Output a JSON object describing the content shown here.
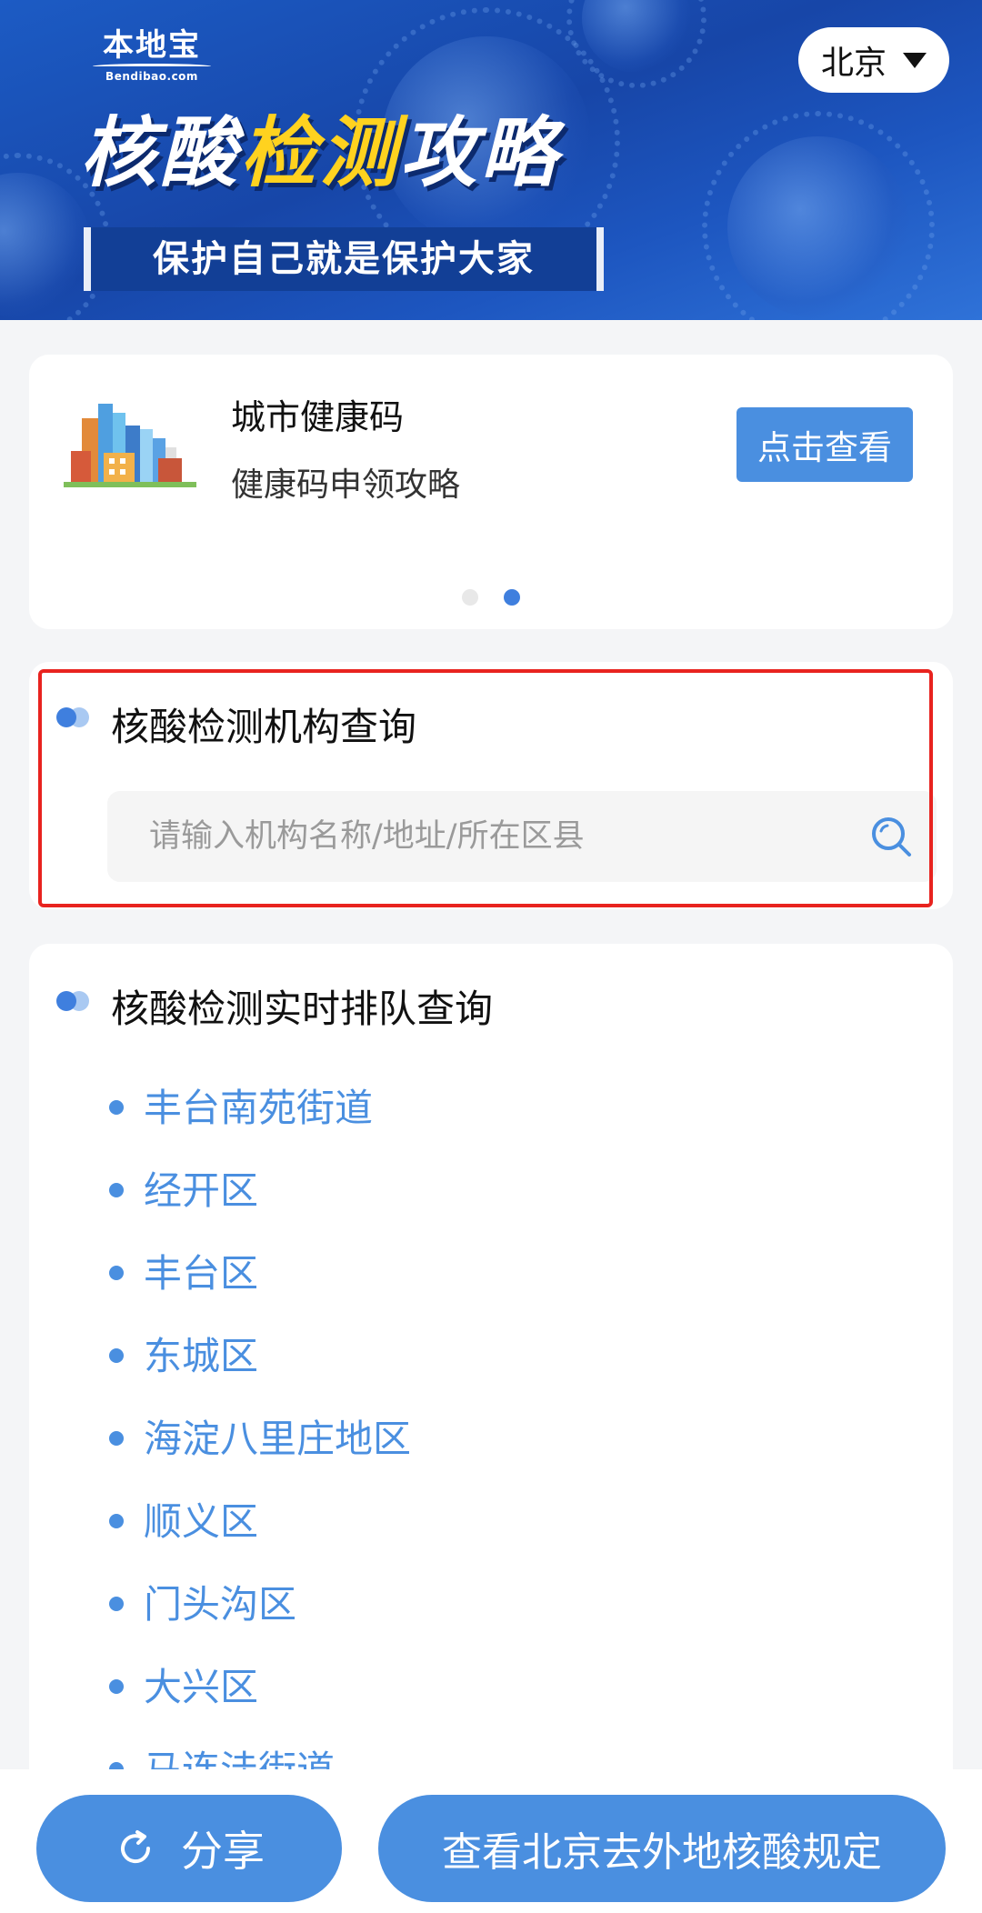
{
  "banner": {
    "logo_text": "本地宝",
    "logo_sub": "Bendibao.com",
    "title_part1": "核酸",
    "title_highlight": "检测",
    "title_part2": "攻略",
    "tagline": "保护自己就是保护大家",
    "city": "北京",
    "colors": {
      "background": "#1c5bc4",
      "highlight": "#ffd21f"
    }
  },
  "health_card": {
    "title": "城市健康码",
    "subtitle": "健康码申领攻略",
    "button_label": "点击查看",
    "carousel_active_index": 2,
    "carousel_total": 2
  },
  "search_section": {
    "title": "核酸检测机构查询",
    "placeholder": "请输入机构名称/地址/所在区县",
    "value": ""
  },
  "queue_section": {
    "title": "核酸检测实时排队查询",
    "items": [
      {
        "label": "丰台南苑街道"
      },
      {
        "label": "经开区"
      },
      {
        "label": "丰台区"
      },
      {
        "label": "东城区"
      },
      {
        "label": "海淀八里庄地区"
      },
      {
        "label": "顺义区"
      },
      {
        "label": "门头沟区"
      },
      {
        "label": "大兴区"
      },
      {
        "label": "马连洼街道"
      }
    ]
  },
  "bottom_bar": {
    "share_label": "分享",
    "rules_label": "查看北京去外地核酸规定"
  },
  "theme": {
    "accent": "#4a8fe0",
    "highlight_border": "#e8231f"
  }
}
